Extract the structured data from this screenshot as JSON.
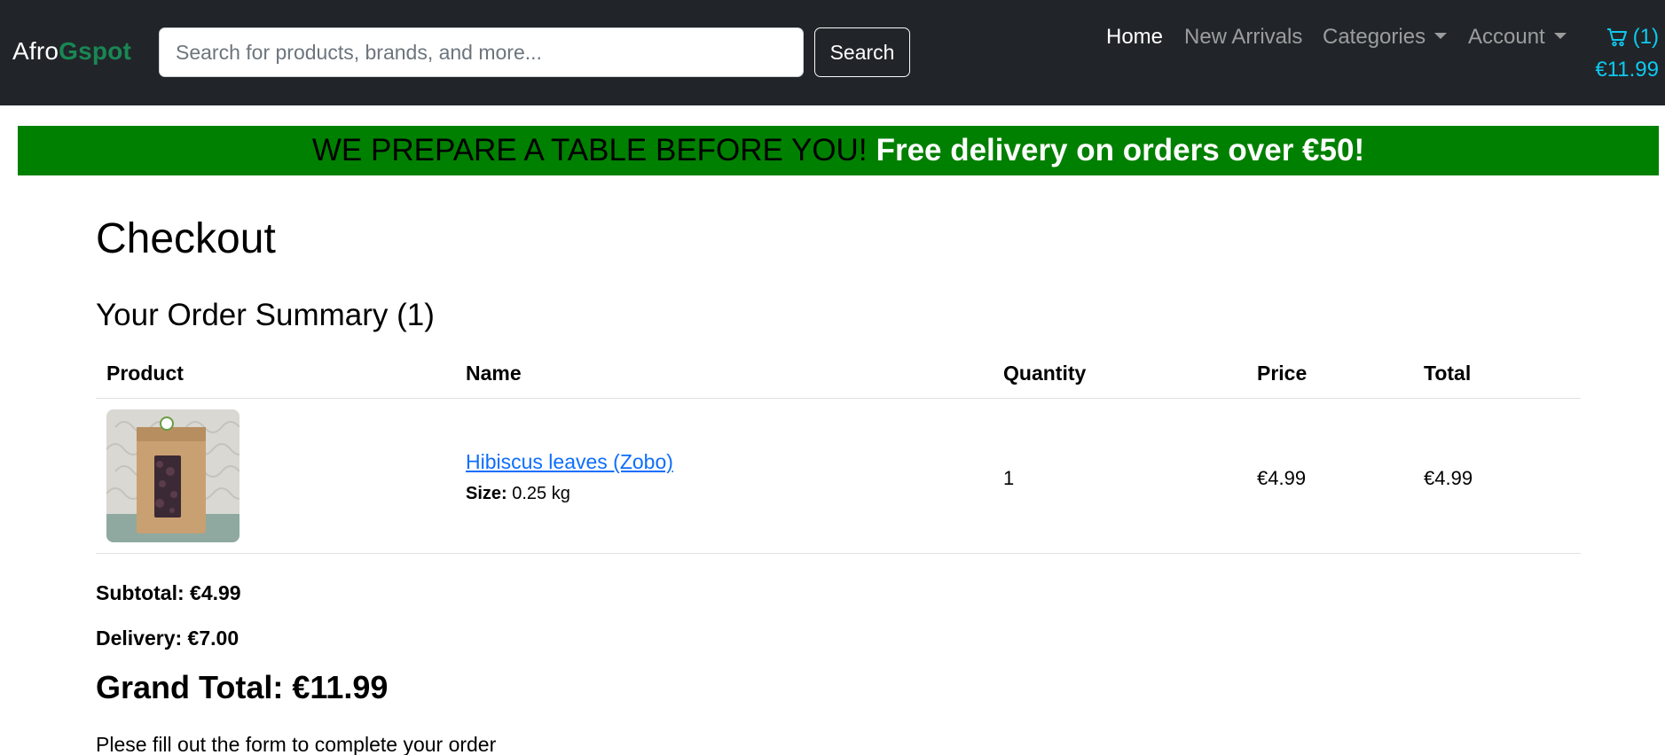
{
  "navbar": {
    "brand_part1": "Afro",
    "brand_part2": "Gspot",
    "search_placeholder": "Search for products, brands, and more...",
    "search_value": "",
    "search_button": "Search",
    "links": {
      "home": "Home",
      "new_arrivals": "New Arrivals",
      "categories": "Categories",
      "account": "Account"
    },
    "cart": {
      "count": "(1)",
      "total": "€11.99",
      "icon": "cart-icon"
    }
  },
  "promo": {
    "part1": "WE PREPARE A TABLE BEFORE YOU!",
    "part2": "Free delivery on orders over €50!"
  },
  "checkout": {
    "title": "Checkout",
    "summary_title": "Your Order Summary (1)",
    "columns": {
      "product": "Product",
      "name": "Name",
      "quantity": "Quantity",
      "price": "Price",
      "total": "Total"
    },
    "items": [
      {
        "name": "Hibiscus leaves (Zobo)",
        "size_label": "Size:",
        "size_value": "0.25 kg",
        "quantity": "1",
        "price": "€4.99",
        "total": "€4.99"
      }
    ],
    "subtotal": "Subtotal: €4.99",
    "delivery": "Delivery: €7.00",
    "grand_total": "Grand Total: €11.99",
    "instructions": "Plese fill out the form to complete your order"
  },
  "colors": {
    "navbar_bg": "#212529",
    "brand_accent": "#198754",
    "promo_bg": "#008000",
    "cart_accent": "#0dcaf0",
    "link": "#0d6efd"
  }
}
